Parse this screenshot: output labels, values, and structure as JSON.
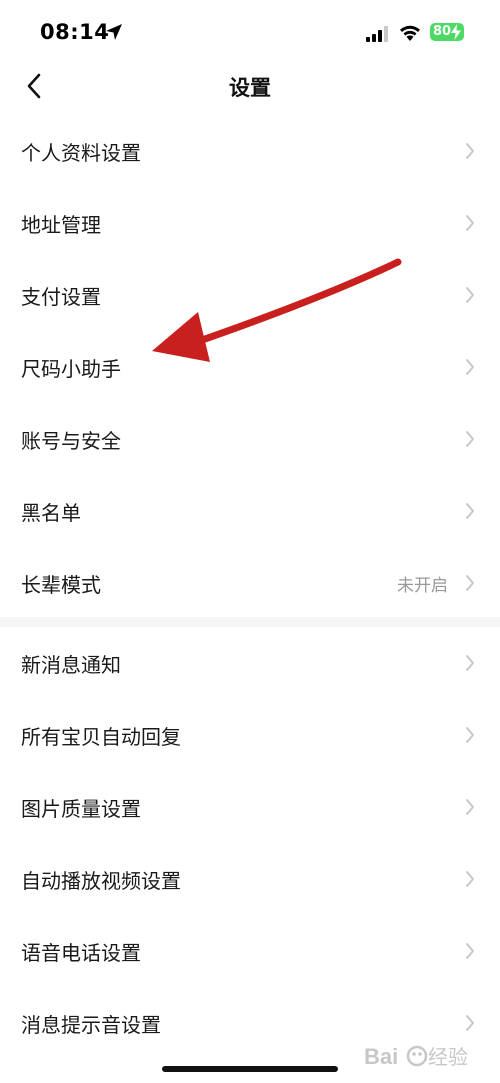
{
  "status_bar": {
    "time": "08:14",
    "battery": "80"
  },
  "nav": {
    "title": "设置"
  },
  "groups": [
    {
      "items": [
        {
          "label": "个人资料设置"
        },
        {
          "label": "地址管理"
        },
        {
          "label": "支付设置"
        },
        {
          "label": "尺码小助手"
        },
        {
          "label": "账号与安全"
        },
        {
          "label": "黑名单"
        },
        {
          "label": "长辈模式",
          "value": "未开启"
        }
      ]
    },
    {
      "items": [
        {
          "label": "新消息通知"
        },
        {
          "label": "所有宝贝自动回复"
        },
        {
          "label": "图片质量设置"
        },
        {
          "label": "自动播放视频设置"
        },
        {
          "label": "语音电话设置"
        },
        {
          "label": "消息提示音设置"
        }
      ]
    }
  ],
  "icons": {
    "back": "chevron-left-icon",
    "row": "chevron-right-icon",
    "location": "location-arrow-icon",
    "signal": "cellular-signal-icon",
    "wifi": "wifi-icon",
    "battery": "battery-icon"
  },
  "colors": {
    "annotation_arrow": "#c8201f",
    "battery": "#4cd964",
    "separator": "#f5f5f5",
    "chevron": "#c7c7c7"
  },
  "watermark": {
    "text": "Baidu经验"
  }
}
